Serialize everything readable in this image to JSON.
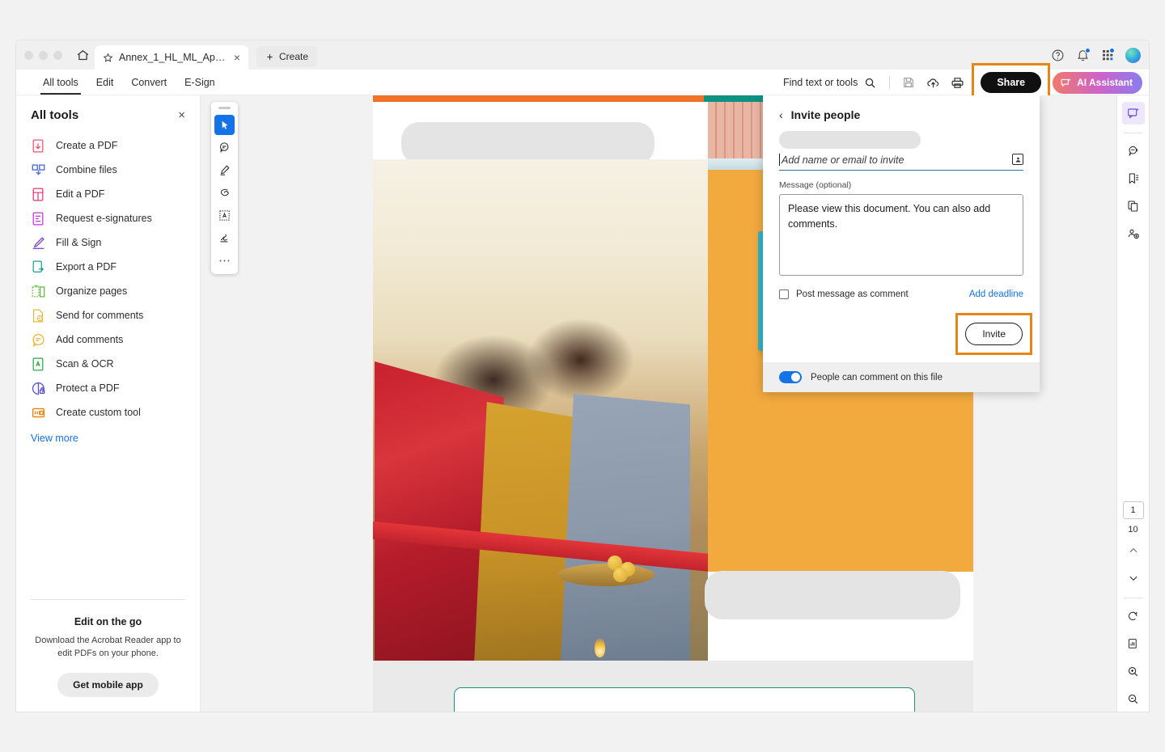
{
  "window": {
    "home_tooltip": "Home",
    "tab": {
      "title": "Annex_1_HL_ML_Appl...",
      "close": "×"
    },
    "new_tab_label": "Create",
    "right_icons": [
      "help-icon",
      "notifications-icon",
      "apps-grid-icon",
      "avatar"
    ]
  },
  "menubar": {
    "items": [
      {
        "label": "All tools",
        "active": true
      },
      {
        "label": "Edit",
        "active": false
      },
      {
        "label": "Convert",
        "active": false
      },
      {
        "label": "E-Sign",
        "active": false
      }
    ],
    "find_label": "Find text or tools",
    "tool_icons": [
      "save-icon",
      "upload-cloud-icon",
      "print-icon"
    ],
    "share_label": "Share",
    "ai_label": "AI Assistant",
    "share_highlighted": true,
    "highlight_color": "#e68619"
  },
  "sidebar": {
    "title": "All tools",
    "close": "×",
    "tools": [
      {
        "label": "Create a PDF",
        "icon": "create-pdf-icon",
        "color": "#e8536d"
      },
      {
        "label": "Combine files",
        "icon": "combine-files-icon",
        "color": "#4b6ce0"
      },
      {
        "label": "Edit a PDF",
        "icon": "edit-pdf-icon",
        "color": "#e8366f"
      },
      {
        "label": "Request e-signatures",
        "icon": "request-esign-icon",
        "color": "#c035d4"
      },
      {
        "label": "Fill & Sign",
        "icon": "fill-sign-icon",
        "color": "#7b4ad6"
      },
      {
        "label": "Export a PDF",
        "icon": "export-pdf-icon",
        "color": "#1f9e96"
      },
      {
        "label": "Organize pages",
        "icon": "organize-pages-icon",
        "color": "#6cc04a"
      },
      {
        "label": "Send for comments",
        "icon": "send-comments-icon",
        "color": "#e8b93a"
      },
      {
        "label": "Add comments",
        "icon": "add-comments-icon",
        "color": "#e8b93a"
      },
      {
        "label": "Scan & OCR",
        "icon": "scan-ocr-icon",
        "color": "#2aa84a"
      },
      {
        "label": "Protect a PDF",
        "icon": "protect-pdf-icon",
        "color": "#5a53d8"
      },
      {
        "label": "Create custom tool",
        "icon": "create-custom-tool-icon",
        "color": "#e8860f"
      }
    ],
    "view_more": "View more",
    "promo": {
      "heading": "Edit on the go",
      "body": "Download the Acrobat Reader app to edit PDFs on your phone.",
      "button": "Get mobile app"
    }
  },
  "float_toolbar": {
    "tools": [
      {
        "name": "select-tool",
        "selected": true
      },
      {
        "name": "comment-tool",
        "selected": false
      },
      {
        "name": "highlight-tool",
        "selected": false
      },
      {
        "name": "draw-tool",
        "selected": false
      },
      {
        "name": "text-select-tool",
        "selected": false
      },
      {
        "name": "stamp-tool",
        "selected": false
      },
      {
        "name": "more-tools",
        "selected": false
      }
    ]
  },
  "invite_panel": {
    "back": "‹",
    "title": "Invite people",
    "recipient_placeholder": "Add name or email to invite",
    "recipient_value": "",
    "message_label": "Message (optional)",
    "message_value": "Please view this document. You can also add comments.",
    "checkbox_label": "Post message as comment",
    "checkbox_checked": false,
    "deadline_link": "Add deadline",
    "invite_button": "Invite",
    "invite_highlighted": true,
    "footer_toggle_label": "People can comment on this file",
    "footer_toggle_on": true
  },
  "right_rail": {
    "top_icons": [
      {
        "name": "ai-assistant-panel-icon",
        "active": true
      },
      {
        "name": "comments-panel-icon",
        "active": false
      },
      {
        "name": "bookmarks-panel-icon",
        "active": false
      },
      {
        "name": "page-thumbnails-icon",
        "active": false
      },
      {
        "name": "share-file-icon",
        "active": false
      }
    ],
    "page_current": "1",
    "page_total": "10",
    "bottom_icons": [
      {
        "name": "page-up-icon"
      },
      {
        "name": "page-down-icon"
      },
      {
        "name": "rotate-icon"
      },
      {
        "name": "page-view-icon"
      },
      {
        "name": "zoom-in-icon"
      },
      {
        "name": "zoom-out-icon"
      }
    ]
  },
  "document": {
    "description": "PDF page 1 showing a photograph of a couple cutting a red ribbon in front of a new house, with orange and teal brand bars and redacted grey placeholder blocks."
  }
}
